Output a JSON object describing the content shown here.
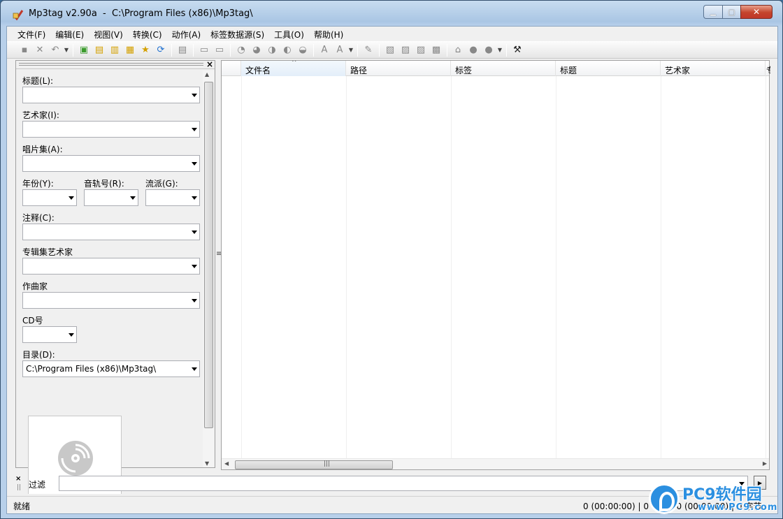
{
  "window": {
    "title": "Mp3tag v2.90a  -  C:\\Program Files (x86)\\Mp3tag\\",
    "min_glyph": "▁",
    "max_glyph": "▢",
    "close_glyph": "✕"
  },
  "menu": [
    "文件(F)",
    "编辑(E)",
    "视图(V)",
    "转换(C)",
    "动作(A)",
    "标签数据源(S)",
    "工具(O)",
    "帮助(H)"
  ],
  "toolbar_icons": [
    "save-icon",
    "remove-tag-icon",
    "undo-icon",
    "change-dir-icon",
    "add-dir-icon",
    "open-folder-icon",
    "favorites-icon",
    "refresh-icon",
    "playlist-icon",
    "copy-tag-icon",
    "paste-tag-icon",
    "tag-to-filename-icon",
    "filename-to-tag-icon",
    "text-to-tag-icon",
    "tag-to-tag-icon",
    "autonumber-icon",
    "case-convert-icon",
    "export-icon",
    "extended-tags-icon",
    "actions-icon",
    "quick-actions-icon",
    "freedb-icon",
    "amazon-icon",
    "discogs-icon",
    "options-icon"
  ],
  "left_panel": {
    "close_glyph": "×",
    "fields": {
      "title_label": "标题(L):",
      "artist_label": "艺术家(I):",
      "album_label": "唱片集(A):",
      "year_label": "年份(Y):",
      "track_label": "音轨号(R):",
      "genre_label": "流派(G):",
      "comment_label": "注释(C):",
      "album_artist_label": "专辑集艺术家",
      "composer_label": "作曲家",
      "cd_label": "CD号",
      "directory_label": "目录(D):",
      "directory_value": "C:\\Program Files (x86)\\Mp3tag\\"
    }
  },
  "file_list": {
    "columns": [
      "文件名",
      "路径",
      "标签",
      "标题",
      "艺术家",
      "专"
    ],
    "sorted_column": "文件名"
  },
  "filter": {
    "label": "过滤",
    "value": ""
  },
  "status": {
    "left": "就绪",
    "right": "0 (00:00:00) | 0 字节 | 0 (00:00:00) | 0 字节"
  },
  "watermark": {
    "text": "PC9软件园",
    "sub": "www.PC9.com"
  },
  "colors": {
    "accent": "#2b8fe0",
    "window_frame": "#aac6e4",
    "close_button": "#c4442c"
  }
}
